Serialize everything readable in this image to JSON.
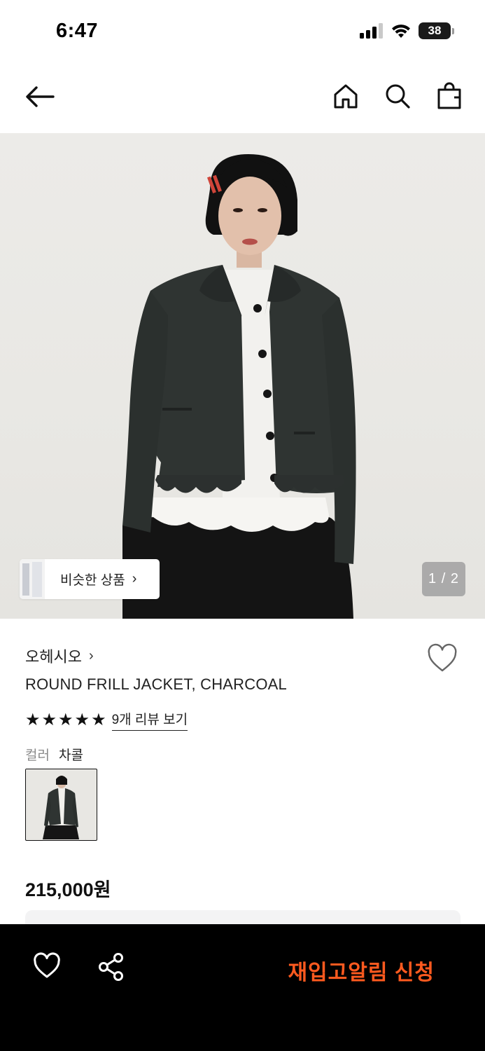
{
  "status_bar": {
    "time": "6:47",
    "battery": "38"
  },
  "header": {
    "back_icon": "arrow-left-icon",
    "home_icon": "home-icon",
    "search_icon": "search-icon",
    "bag_icon": "shopping-bag-icon"
  },
  "gallery": {
    "similar_label": "비슷한 상품",
    "similar_chevron": "›",
    "page_indicator": "1 / 2"
  },
  "product": {
    "brand": "오헤시오",
    "brand_chevron": "›",
    "name": "ROUND FRILL JACKET, CHARCOAL",
    "rating_stars": 5,
    "review_link": "9개 리뷰 보기",
    "color_label": "컬러",
    "color_value": "차콜",
    "price": "215,000원"
  },
  "bottom_bar": {
    "restock_label": "재입고알림 신청"
  },
  "colors": {
    "accent": "#ff5a1f",
    "bottom_bar_bg": "#000000",
    "jacket": "#2f3432"
  }
}
